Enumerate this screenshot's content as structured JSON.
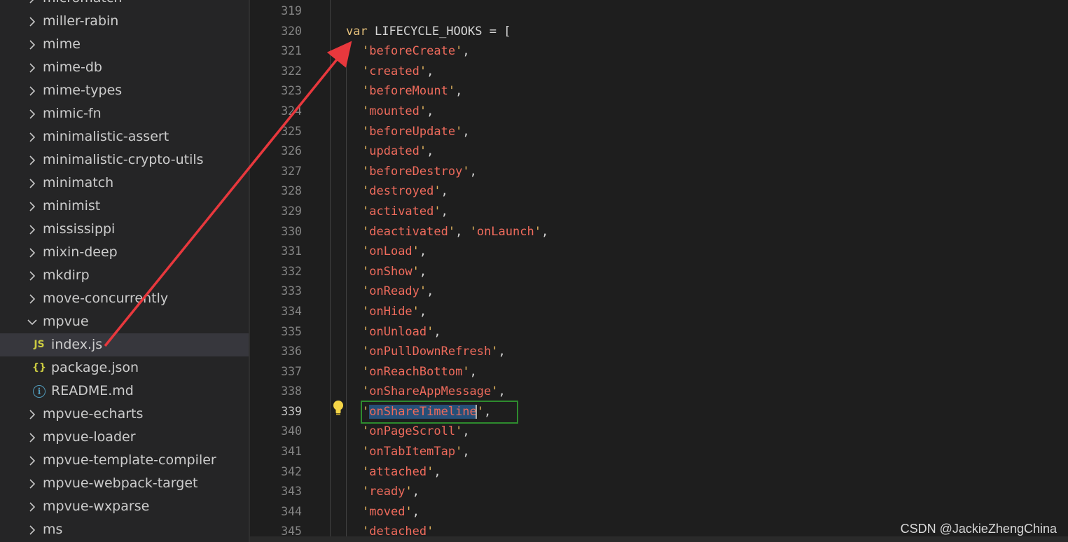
{
  "explorer": {
    "items": [
      {
        "kind": "folder",
        "label": "micromatch",
        "expanded": false
      },
      {
        "kind": "folder",
        "label": "miller-rabin",
        "expanded": false
      },
      {
        "kind": "folder",
        "label": "mime",
        "expanded": false
      },
      {
        "kind": "folder",
        "label": "mime-db",
        "expanded": false
      },
      {
        "kind": "folder",
        "label": "mime-types",
        "expanded": false
      },
      {
        "kind": "folder",
        "label": "mimic-fn",
        "expanded": false
      },
      {
        "kind": "folder",
        "label": "minimalistic-assert",
        "expanded": false
      },
      {
        "kind": "folder",
        "label": "minimalistic-crypto-utils",
        "expanded": false
      },
      {
        "kind": "folder",
        "label": "minimatch",
        "expanded": false
      },
      {
        "kind": "folder",
        "label": "minimist",
        "expanded": false
      },
      {
        "kind": "folder",
        "label": "mississippi",
        "expanded": false
      },
      {
        "kind": "folder",
        "label": "mixin-deep",
        "expanded": false
      },
      {
        "kind": "folder",
        "label": "mkdirp",
        "expanded": false
      },
      {
        "kind": "folder",
        "label": "move-concurrently",
        "expanded": false
      },
      {
        "kind": "folder",
        "label": "mpvue",
        "expanded": true
      },
      {
        "kind": "file",
        "label": "index.js",
        "icon": "js-file-icon",
        "icon_text": "JS",
        "icon_color": "#cbcb41",
        "selected": true
      },
      {
        "kind": "file",
        "label": "package.json",
        "icon": "json-file-icon",
        "icon_text": "{}",
        "icon_color": "#cbcb41",
        "selected": false
      },
      {
        "kind": "file",
        "label": "README.md",
        "icon": "info-icon",
        "icon_text": "i",
        "icon_color": "#519aba",
        "selected": false
      },
      {
        "kind": "folder",
        "label": "mpvue-echarts",
        "expanded": false
      },
      {
        "kind": "folder",
        "label": "mpvue-loader",
        "expanded": false
      },
      {
        "kind": "folder",
        "label": "mpvue-template-compiler",
        "expanded": false
      },
      {
        "kind": "folder",
        "label": "mpvue-webpack-target",
        "expanded": false
      },
      {
        "kind": "folder",
        "label": "mpvue-wxparse",
        "expanded": false
      },
      {
        "kind": "folder",
        "label": "ms",
        "expanded": false
      }
    ]
  },
  "editor": {
    "active_line": "339",
    "lines": [
      {
        "n": "319",
        "kind": "empty"
      },
      {
        "n": "320",
        "kind": "decl",
        "keyword": "var",
        "name": "LIFECYCLE_HOOKS",
        "rest": " = ["
      },
      {
        "n": "321",
        "kind": "str",
        "value": "beforeCreate",
        "suffix": ","
      },
      {
        "n": "322",
        "kind": "str",
        "value": "created",
        "suffix": ","
      },
      {
        "n": "323",
        "kind": "str",
        "value": "beforeMount",
        "suffix": ","
      },
      {
        "n": "324",
        "kind": "str",
        "value": "mounted",
        "suffix": ","
      },
      {
        "n": "325",
        "kind": "str",
        "value": "beforeUpdate",
        "suffix": ","
      },
      {
        "n": "326",
        "kind": "str",
        "value": "updated",
        "suffix": ","
      },
      {
        "n": "327",
        "kind": "str",
        "value": "beforeDestroy",
        "suffix": ","
      },
      {
        "n": "328",
        "kind": "str",
        "value": "destroyed",
        "suffix": ","
      },
      {
        "n": "329",
        "kind": "str",
        "value": "activated",
        "suffix": ","
      },
      {
        "n": "330",
        "kind": "str2",
        "value": "deactivated",
        "value2": "onLaunch",
        "suffix": ","
      },
      {
        "n": "331",
        "kind": "str",
        "value": "onLoad",
        "suffix": ","
      },
      {
        "n": "332",
        "kind": "str",
        "value": "onShow",
        "suffix": ","
      },
      {
        "n": "333",
        "kind": "str",
        "value": "onReady",
        "suffix": ","
      },
      {
        "n": "334",
        "kind": "str",
        "value": "onHide",
        "suffix": ","
      },
      {
        "n": "335",
        "kind": "str",
        "value": "onUnload",
        "suffix": ","
      },
      {
        "n": "336",
        "kind": "str",
        "value": "onPullDownRefresh",
        "suffix": ","
      },
      {
        "n": "337",
        "kind": "str",
        "value": "onReachBottom",
        "suffix": ","
      },
      {
        "n": "338",
        "kind": "str",
        "value": "onShareAppMessage",
        "suffix": ","
      },
      {
        "n": "339",
        "kind": "str",
        "value": "onShareTimeline",
        "suffix": ",",
        "selected": true
      },
      {
        "n": "340",
        "kind": "str",
        "value": "onPageScroll",
        "suffix": ","
      },
      {
        "n": "341",
        "kind": "str",
        "value": "onTabItemTap",
        "suffix": ","
      },
      {
        "n": "342",
        "kind": "str",
        "value": "attached",
        "suffix": ","
      },
      {
        "n": "343",
        "kind": "str",
        "value": "ready",
        "suffix": ","
      },
      {
        "n": "344",
        "kind": "str",
        "value": "moved",
        "suffix": ","
      },
      {
        "n": "345",
        "kind": "str",
        "value": "detached",
        "suffix": ""
      }
    ]
  },
  "colors": {
    "keyword": "#e5c07b",
    "string": "#ef6b5c",
    "quote": "#e8b860",
    "annotation_arrow": "#e8383d",
    "annotation_box": "#2e8b2e",
    "selection": "#264f78"
  },
  "watermark": "CSDN @JackieZhengChina"
}
